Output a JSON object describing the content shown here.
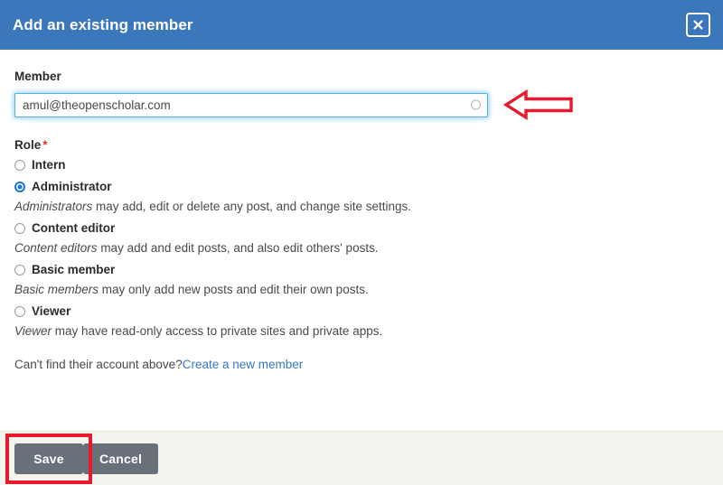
{
  "dialog": {
    "title": "Add an existing member",
    "close_icon": "close-x-icon"
  },
  "member": {
    "label": "Member",
    "value": "amul@theopenscholar.com",
    "placeholder": "",
    "throbber_icon": "circle-throbber-icon",
    "annotation_icon": "red-left-arrow-annotation"
  },
  "role": {
    "label": "Role",
    "required_marker": "*",
    "options": [
      {
        "label": "Intern",
        "selected": false,
        "description_em": "",
        "description_rest": ""
      },
      {
        "label": "Administrator",
        "selected": true,
        "description_em": "Administrators",
        "description_rest": " may add, edit or delete any post, and change site settings."
      },
      {
        "label": "Content editor",
        "selected": false,
        "description_em": "Content editors",
        "description_rest": " may add and edit posts, and also edit others' posts."
      },
      {
        "label": "Basic member",
        "selected": false,
        "description_em": "Basic members",
        "description_rest": " may only add new posts and edit their own posts."
      },
      {
        "label": "Viewer",
        "selected": false,
        "description_em": "Viewer",
        "description_rest": " may have read-only access to private sites and private apps."
      }
    ]
  },
  "create_account": {
    "prompt": "Can't find their account above?",
    "link_label": "Create a new member"
  },
  "footer": {
    "save_label": "Save",
    "cancel_label": "Cancel"
  },
  "colors": {
    "header_blue": "#3d77bb",
    "link_blue": "#3778be",
    "radio_selected_blue": "#1a73e8",
    "required_red": "#ee3322",
    "annotation_red": "#e8192c",
    "button_gray": "#68707a",
    "footer_bg": "#f4f4ef",
    "input_focus_border": "#59b0e8"
  }
}
